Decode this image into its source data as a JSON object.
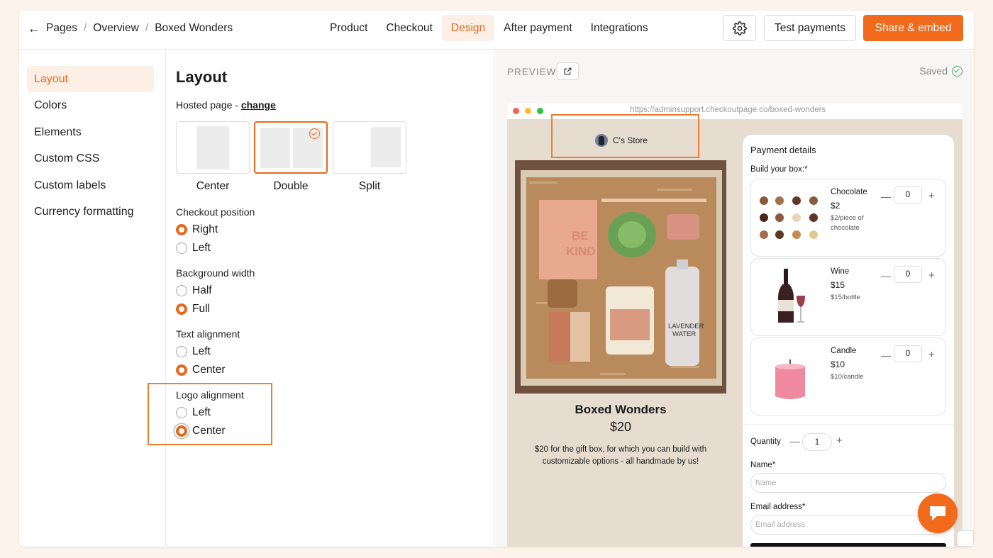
{
  "breadcrumb": {
    "back_icon": "arrow-left-icon",
    "items": [
      "Pages",
      "Overview",
      "Boxed Wonders"
    ]
  },
  "nav": {
    "tabs": [
      "Product",
      "Checkout",
      "Design",
      "After payment",
      "Integrations"
    ],
    "active": "Design"
  },
  "header": {
    "settings_icon": "gear-icon",
    "test_payments": "Test payments",
    "share_embed": "Share & embed"
  },
  "sidebar": {
    "items": [
      "Layout",
      "Colors",
      "Elements",
      "Custom CSS",
      "Custom labels",
      "Currency formatting"
    ],
    "active": "Layout"
  },
  "settings": {
    "title": "Layout",
    "hosted_prefix": "Hosted page - ",
    "hosted_change": "change",
    "layouts": [
      "Center",
      "Double",
      "Split"
    ],
    "selected_layout": "Double",
    "checkout_position": {
      "label": "Checkout position",
      "options": [
        "Right",
        "Left"
      ],
      "selected": "Right"
    },
    "background_width": {
      "label": "Background width",
      "options": [
        "Half",
        "Full"
      ],
      "selected": "Full"
    },
    "text_alignment": {
      "label": "Text alignment",
      "options": [
        "Left",
        "Center"
      ],
      "selected": "Center"
    },
    "logo_alignment": {
      "label": "Logo alignment",
      "options": [
        "Left",
        "Center"
      ],
      "selected": "Center"
    }
  },
  "preview": {
    "label": "PREVIEW",
    "saved": "Saved",
    "url": "https://adminsupport.checkoutpage.co/boxed-wonders",
    "store_name": "C's Store",
    "product": {
      "title": "Boxed Wonders",
      "price": "$20",
      "description": "$20 for the gift box, for which you can build with customizable options - all handmade by us!"
    },
    "card": {
      "title": "Payment details",
      "build_label": "Build your box:",
      "required_mark": "*",
      "items": [
        {
          "name": "Chocolate",
          "price": "$2",
          "unit": "$2/piece of chocolate",
          "qty": "0"
        },
        {
          "name": "Wine",
          "price": "$15",
          "unit": "$15/bottle",
          "qty": "0"
        },
        {
          "name": "Candle",
          "price": "$10",
          "unit": "$10/candle",
          "qty": "0"
        }
      ],
      "quantity_label": "Quantity",
      "quantity": "1",
      "name_label": "Name",
      "name_placeholder": "Name",
      "email_label": "Email address",
      "email_placeholder": "Email address"
    }
  },
  "colors": {
    "accent": "#f26a1b",
    "highlight": "#ef7d2e",
    "success": "#4aa96c"
  }
}
